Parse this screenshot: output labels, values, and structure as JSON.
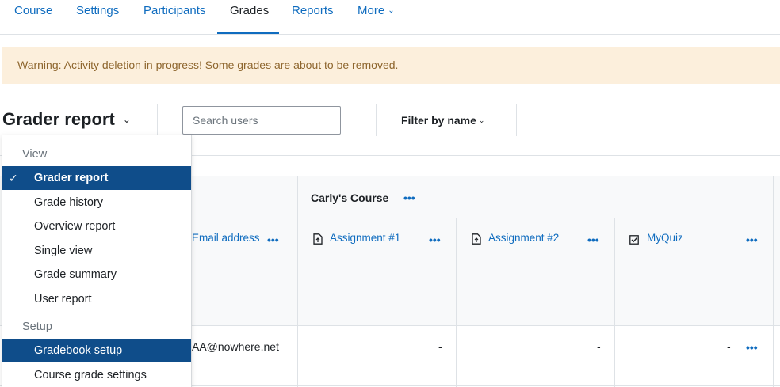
{
  "nav": {
    "tabs": [
      "Course",
      "Settings",
      "Participants",
      "Grades",
      "Reports"
    ],
    "more": "More"
  },
  "alert": {
    "text": "Warning: Activity deletion in progress! Some grades are about to be removed."
  },
  "toolbar": {
    "report_select": "Grader report",
    "search_placeholder": "Search users",
    "filter_label": "Filter by name"
  },
  "grid": {
    "course_name": "Carly's Course",
    "columns": [
      {
        "label": "Email address",
        "icon": "none"
      },
      {
        "label": "Assignment #1",
        "icon": "assignment-icon"
      },
      {
        "label": "Assignment #2",
        "icon": "assignment-icon"
      },
      {
        "label": "MyQuiz",
        "icon": "quiz-icon"
      }
    ],
    "row": {
      "email": "AA@nowhere.net",
      "grades": [
        "-",
        "-",
        "-"
      ]
    },
    "dots": "•••"
  },
  "menu": {
    "view_header": "View",
    "view_items": [
      "Grader report",
      "Grade history",
      "Overview report",
      "Single view",
      "Grade summary",
      "User report"
    ],
    "setup_header": "Setup",
    "setup_items": [
      "Gradebook setup",
      "Course grade settings"
    ],
    "check": "✓"
  },
  "colors": {
    "accent": "#0f6cbf",
    "menu_selected": "#0f4d8a",
    "alert_bg": "#fcefdc",
    "alert_text": "#8e662e"
  }
}
